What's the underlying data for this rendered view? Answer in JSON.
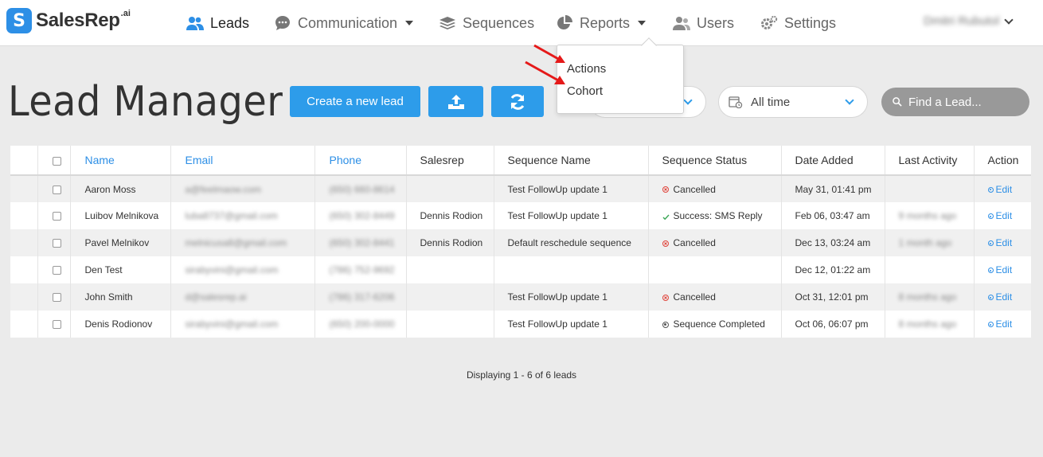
{
  "brand": {
    "name": "SalesRep",
    "suffix": ".ai",
    "mark": "S"
  },
  "nav": {
    "leads": "Leads",
    "communication": "Communication",
    "sequences": "Sequences",
    "reports": "Reports",
    "users": "Users",
    "settings": "Settings"
  },
  "user": {
    "name": "Dmitri Rubutol"
  },
  "reports_menu": {
    "items": [
      "Actions",
      "Cohort"
    ]
  },
  "page": {
    "title": "Lead Manager"
  },
  "toolbar": {
    "create_label": "Create a new lead",
    "upload_icon": "upload-icon",
    "refresh_icon": "refresh-icon",
    "date_filter": "All time",
    "search_placeholder": "Find a Lead..."
  },
  "table": {
    "headers": [
      "Name",
      "Email",
      "Phone",
      "Salesrep",
      "Sequence Name",
      "Sequence Status",
      "Date Added",
      "Last Activity",
      "Action"
    ],
    "rows": [
      {
        "name": "Aaron Moss",
        "email": "a@feelmaow.com",
        "phone": "(650) 660-8614",
        "salesrep": "",
        "sequence": "Test FollowUp update 1",
        "status": "Cancelled",
        "status_type": "cancel",
        "date": "May 31, 01:41 pm",
        "activity": "",
        "action": "Edit"
      },
      {
        "name": "Luibov Melnikova",
        "email": "luba8737@gmail.com",
        "phone": "(650) 302-8449",
        "salesrep": "Dennis Rodion",
        "sequence": "Test FollowUp update 1",
        "status": "Success: SMS Reply",
        "status_type": "success",
        "date": "Feb 06, 03:47 am",
        "activity": "9 months ago",
        "action": "Edit"
      },
      {
        "name": "Pavel Melnikov",
        "email": "melnicusa8@gmail.com",
        "phone": "(650) 302-8441",
        "salesrep": "Dennis Rodion",
        "sequence": "Default reschedule sequence",
        "status": "Cancelled",
        "status_type": "cancel",
        "date": "Dec 13, 03:24 am",
        "activity": "1 month ago",
        "action": "Edit"
      },
      {
        "name": "Den Test",
        "email": "sirabyvini@gmail.com",
        "phone": "(786) 752-9692",
        "salesrep": "",
        "sequence": "",
        "status": "",
        "status_type": "",
        "date": "Dec 12, 01:22 am",
        "activity": "",
        "action": "Edit"
      },
      {
        "name": "John Smith",
        "email": "d@salesrep.ai",
        "phone": "(786) 317-6206",
        "salesrep": "",
        "sequence": "Test FollowUp update 1",
        "status": "Cancelled",
        "status_type": "cancel",
        "date": "Oct 31, 12:01 pm",
        "activity": "8 months ago",
        "action": "Edit"
      },
      {
        "name": "Denis Rodionov",
        "email": "sirabyvini@gmail.com",
        "phone": "(650) 200-0000",
        "salesrep": "",
        "sequence": "Test FollowUp update 1",
        "status": "Sequence Completed",
        "status_type": "done",
        "date": "Oct 06, 06:07 pm",
        "activity": "8 months ago",
        "action": "Edit"
      }
    ]
  },
  "pager": {
    "prefix": "Displaying ",
    "range": "1 - 6",
    "mid": " of ",
    "total": "6",
    "suffix": " leads"
  },
  "colors": {
    "accent": "#2d9cea",
    "cancel": "#e0453c",
    "success": "#3aa655"
  }
}
